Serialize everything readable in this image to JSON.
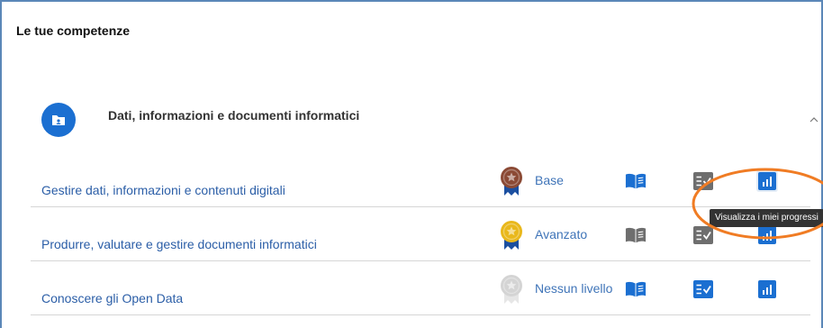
{
  "section_title": "Le tue competenze",
  "area": {
    "title": "Dati, informazioni e documenti informatici",
    "icon": "folder-user-icon",
    "color": "#1b6fd1",
    "collapse_icon": "chevron-up-icon"
  },
  "competences": [
    {
      "name": "Gestire dati, informazioni e contenuti digitali",
      "level": "Base",
      "medal": "bronze",
      "medal_color": "#8b4a35",
      "book_active": true,
      "test_active": false,
      "progress_active": true,
      "progress_hover": true
    },
    {
      "name": "Produrre, valutare e gestire documenti informatici",
      "level": "Avanzato",
      "medal": "gold",
      "medal_color": "#e9b81c",
      "book_active": false,
      "test_active": false,
      "progress_active": true,
      "progress_hover": false
    },
    {
      "name": "Conoscere gli Open Data",
      "level": "Nessun livello",
      "medal": "none",
      "medal_color": "#d4d4d4",
      "book_active": true,
      "test_active": true,
      "progress_active": true,
      "progress_hover": false
    }
  ],
  "tooltip": "Visualizza i miei progressi",
  "colors": {
    "active_icon": "#1b6fd1",
    "inactive_icon": "#6e6e6e",
    "link": "#2b5ea7",
    "annotation": "#f07c24",
    "border": "#5b87b8"
  }
}
